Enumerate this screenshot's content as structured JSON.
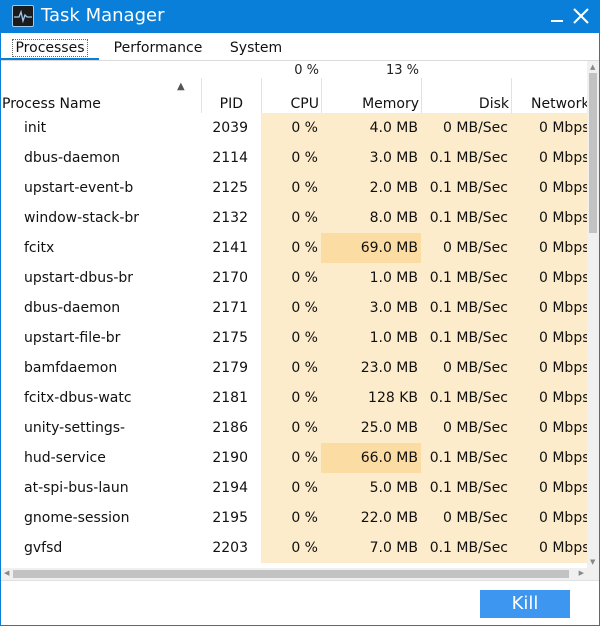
{
  "window": {
    "title": "Task Manager"
  },
  "tabs": [
    {
      "label": "Processes"
    },
    {
      "label": "Performance"
    },
    {
      "label": "System"
    }
  ],
  "table": {
    "columns": {
      "name": "Process Name",
      "pid": "PID",
      "cpu": "CPU",
      "memory": "Memory",
      "disk": "Disk",
      "network": "Network"
    },
    "totals": {
      "cpu": "0 %",
      "memory": "13 %"
    },
    "sort_indicator": "▲",
    "rows": [
      {
        "name": "init",
        "pid": "2039",
        "cpu": "0 %",
        "memory": "4.0 MB",
        "disk": "0 MB/Sec",
        "network": "0 Mbps"
      },
      {
        "name": "dbus-daemon",
        "pid": "2114",
        "cpu": "0 %",
        "memory": "3.0 MB",
        "disk": "0.1 MB/Sec",
        "network": "0 Mbps"
      },
      {
        "name": "upstart-event-b",
        "pid": "2125",
        "cpu": "0 %",
        "memory": "2.0 MB",
        "disk": "0.1 MB/Sec",
        "network": "0 Mbps"
      },
      {
        "name": "window-stack-br",
        "pid": "2132",
        "cpu": "0 %",
        "memory": "8.0 MB",
        "disk": "0.1 MB/Sec",
        "network": "0 Mbps"
      },
      {
        "name": "fcitx",
        "pid": "2141",
        "cpu": "0 %",
        "memory": "69.0 MB",
        "disk": "0 MB/Sec",
        "network": "0 Mbps"
      },
      {
        "name": "upstart-dbus-br",
        "pid": "2170",
        "cpu": "0 %",
        "memory": "1.0 MB",
        "disk": "0.1 MB/Sec",
        "network": "0 Mbps"
      },
      {
        "name": "dbus-daemon",
        "pid": "2171",
        "cpu": "0 %",
        "memory": "3.0 MB",
        "disk": "0.1 MB/Sec",
        "network": "0 Mbps"
      },
      {
        "name": "upstart-file-br",
        "pid": "2175",
        "cpu": "0 %",
        "memory": "1.0 MB",
        "disk": "0.1 MB/Sec",
        "network": "0 Mbps"
      },
      {
        "name": "bamfdaemon",
        "pid": "2179",
        "cpu": "0 %",
        "memory": "23.0 MB",
        "disk": "0 MB/Sec",
        "network": "0 Mbps"
      },
      {
        "name": "fcitx-dbus-watc",
        "pid": "2181",
        "cpu": "0 %",
        "memory": "128 KB",
        "disk": "0.1 MB/Sec",
        "network": "0 Mbps"
      },
      {
        "name": "unity-settings-",
        "pid": "2186",
        "cpu": "0 %",
        "memory": "25.0 MB",
        "disk": "0 MB/Sec",
        "network": "0 Mbps"
      },
      {
        "name": "hud-service",
        "pid": "2190",
        "cpu": "0 %",
        "memory": "66.0 MB",
        "disk": "0.1 MB/Sec",
        "network": "0 Mbps"
      },
      {
        "name": "at-spi-bus-laun",
        "pid": "2194",
        "cpu": "0 %",
        "memory": "5.0 MB",
        "disk": "0.1 MB/Sec",
        "network": "0 Mbps"
      },
      {
        "name": "gnome-session",
        "pid": "2195",
        "cpu": "0 %",
        "memory": "22.0 MB",
        "disk": "0 MB/Sec",
        "network": "0 Mbps"
      },
      {
        "name": "gvfsd",
        "pid": "2203",
        "cpu": "0 %",
        "memory": "7.0 MB",
        "disk": "0.1 MB/Sec",
        "network": "0 Mbps"
      }
    ]
  },
  "footer": {
    "kill_label": "Kill"
  },
  "colors": {
    "titlebar": "#0a7fd9",
    "cell_bg": "#fdeccb",
    "cell_bg_hot": "#fbdca3",
    "kill_button": "#3d96f0"
  }
}
